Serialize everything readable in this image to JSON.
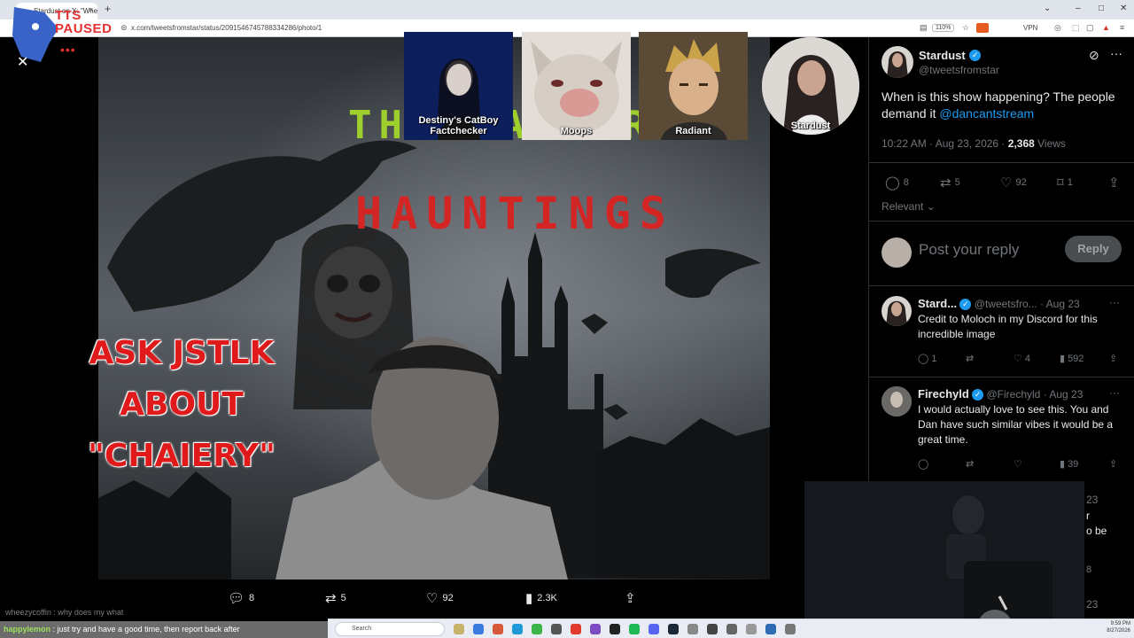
{
  "browser": {
    "tab_title": "Stardust on X: \"When is this",
    "url": "x.com/tweetsfromstar/status/2091546745788334286/photo/1",
    "zoom": "110%",
    "vpn_label": "VPN"
  },
  "stream": {
    "tts_status": "TTS PAUSED",
    "ask_text": "ASK JSTLK ABOUT \"CHAIERY\"",
    "title_line1": "THE CALTURIAN",
    "title_line2": "HAUNTINGS",
    "cams": [
      {
        "label": "Destiny's CatBoy Factchecker"
      },
      {
        "label": "Moops"
      },
      {
        "label": "Radiant"
      },
      {
        "label": "Stardust"
      }
    ]
  },
  "photo_actions": {
    "replies": "8",
    "reposts": "5",
    "likes": "92",
    "views": "2.3K"
  },
  "post": {
    "author_name": "Stardust",
    "author_handle": "@tweetsfromstar",
    "text": "When is this show happening? The people demand it ",
    "mention": "@dancantstream",
    "time": "10:22 AM · Aug 23, 2026 · ",
    "views_count": "2,368",
    "views_label": " Views",
    "replies": "8",
    "reposts": "5",
    "likes": "92",
    "bookmarks": "1",
    "sort_label": "Relevant",
    "reply_placeholder": "Post your reply",
    "reply_button": "Reply"
  },
  "replies": [
    {
      "name": "Stard...",
      "handle": "@tweetsfro...",
      "date": "· Aug 23",
      "text": "Credit to Moloch in my Discord for this incredible image",
      "replies": "1",
      "reposts": "",
      "likes": "4",
      "views": "592"
    },
    {
      "name": "Firechyld",
      "handle": "@Firechyld",
      "date": "· Aug 23",
      "text": "I would actually love to see this. You and Dan have such similar vibes it would be a great time.",
      "replies": "",
      "reposts": "",
      "likes": "",
      "views": "39"
    }
  ],
  "right_strip": {
    "date": "23",
    "text1": "r",
    "text2": "o be",
    "count1": "8",
    "date2": "23"
  },
  "chat": {
    "faded_line": "wheezycoffin : why does my what",
    "user": "happylemon",
    "message": " : just try and have a good time, then report back after"
  },
  "taskbar": {
    "search_placeholder": "Search",
    "time": "9:59 PM",
    "date": "8/27/2026"
  },
  "colors": {
    "accent": "#1d9bf0",
    "title_green": "#9fcf2c",
    "title_red": "#d42525",
    "ask_red": "#e01a1a"
  }
}
